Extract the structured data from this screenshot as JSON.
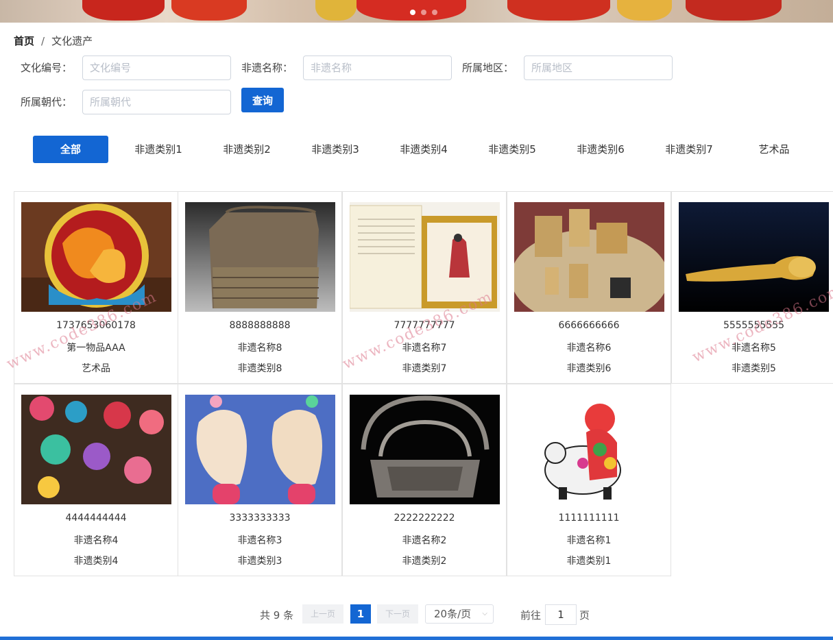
{
  "breadcrumb": {
    "home": "首页",
    "separator": "/",
    "current": "文化遗产"
  },
  "search": {
    "code_label": "文化编号：",
    "code_placeholder": "文化编号",
    "name_label": "非遗名称：",
    "name_placeholder": "非遗名称",
    "region_label": "所属地区：",
    "region_placeholder": "所属地区",
    "dynasty_label": "所属朝代：",
    "dynasty_placeholder": "所属朝代",
    "query_label": "查询"
  },
  "categories": [
    "全部",
    "非遗类别1",
    "非遗类别2",
    "非遗类别3",
    "非遗类别4",
    "非遗类别5",
    "非遗类别6",
    "非遗类别7",
    "艺术品"
  ],
  "items": [
    {
      "code": "1737653060178",
      "name": "第一物品AAA",
      "category": "艺术品"
    },
    {
      "code": "8888888888",
      "name": "非遗名称8",
      "category": "非遗类别8"
    },
    {
      "code": "7777777777",
      "name": "非遗名称7",
      "category": "非遗类别7"
    },
    {
      "code": "6666666666",
      "name": "非遗名称6",
      "category": "非遗类别6"
    },
    {
      "code": "5555555555",
      "name": "非遗名称5",
      "category": "非遗类别5"
    },
    {
      "code": "4444444444",
      "name": "非遗名称4",
      "category": "非遗类别4"
    },
    {
      "code": "3333333333",
      "name": "非遗名称3",
      "category": "非遗类别3"
    },
    {
      "code": "2222222222",
      "name": "非遗名称2",
      "category": "非遗类别2"
    },
    {
      "code": "1111111111",
      "name": "非遗名称1",
      "category": "非遗类别1"
    }
  ],
  "pagination": {
    "total": "共 9 条",
    "prev": "上一页",
    "current_page": "1",
    "next": "下一页",
    "page_size": "20条/页",
    "goto_label": "前往",
    "goto_value": "1",
    "page_label": "页"
  },
  "watermark": "www.code386.com",
  "colors": {
    "primary": "#1366d3",
    "border": "#e2e2e2"
  }
}
